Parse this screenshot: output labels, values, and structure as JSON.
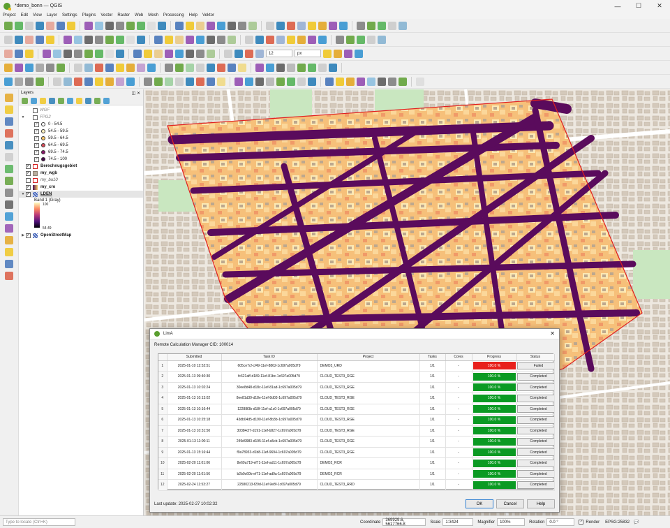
{
  "window": {
    "title": "*demo_bonn — QGIS"
  },
  "menu": [
    "Project",
    "Edit",
    "View",
    "Layer",
    "Settings",
    "Plugins",
    "Vector",
    "Raster",
    "Web",
    "Mesh",
    "Processing",
    "Help",
    "Vektor"
  ],
  "toolbar3": {
    "font_size": "12",
    "unit": "px"
  },
  "layers_panel": {
    "title": "Layers",
    "items": [
      {
        "label": "WGF",
        "kind": "hidden"
      },
      {
        "label": "FPG2",
        "kind": "group"
      },
      {
        "label": "0 - 54.5",
        "color": "#fdfdfd"
      },
      {
        "label": "54.5 - 59.5",
        "color": "#fdf1c0"
      },
      {
        "label": "59.5 - 64.5",
        "color": "#f7c66a"
      },
      {
        "label": "64.5 - 69.5",
        "color": "#d94f5c"
      },
      {
        "label": "69.5 - 74.5",
        "color": "#8b1a6a"
      },
      {
        "label": "74.5 - 100",
        "color": "#4a0c4e"
      },
      {
        "label": "Berechnugsgebiet",
        "kind": "poly"
      },
      {
        "label": "my_wgb",
        "kind": "poly"
      },
      {
        "label": "my_ba10",
        "kind": "poly"
      },
      {
        "label": "my_cro",
        "kind": "raster"
      },
      {
        "label": "LDEN",
        "kind": "raster"
      },
      {
        "label": "Band 1 (Gray)",
        "kind": "band"
      },
      {
        "label": "100",
        "kind": "rampmax"
      },
      {
        "label": "54.49",
        "kind": "rampmin"
      },
      {
        "label": "OpenStreetMap",
        "kind": "osm"
      }
    ]
  },
  "statusbar": {
    "locate_placeholder": "Type to locate (Ctrl+K)",
    "coordinate_label": "Coordinate",
    "coordinate": "369929.6, 5617766.8",
    "scale_label": "Scale",
    "scale": "1:3424",
    "magnifier_label": "Magnifier",
    "magnifier": "100%",
    "rotation_label": "Rotation",
    "rotation": "0.0 °",
    "render_label": "Render",
    "crs": "EPSG:25832"
  },
  "dialog": {
    "title": "LimA",
    "cid_label": "Remote Calculation Manager CID: 100014",
    "columns": [
      "",
      "Submitted",
      "Task ID",
      "Project",
      "Tasks",
      "Cores",
      "Progress",
      "Status"
    ],
    "rows": [
      {
        "n": "1",
        "submitted": "2025-01-10 12:52:51",
        "task": "605ce7cf-cf49-11ef-8862-1c697a005d79",
        "project": "DEMO3_URD",
        "tasks": "1/1",
        "cores": "-",
        "progress": "100.0 %",
        "progress_value": 100,
        "progress_color": "#e8201c",
        "status": "Failed"
      },
      {
        "n": "2",
        "submitted": "2025-01-13 09:40:30",
        "task": "fc621aff-d189-11ef-81bc-1c697a005d79",
        "project": "CLOUD_TEST3_RGE",
        "tasks": "1/1",
        "cores": "-",
        "progress": "100.0 %",
        "progress_value": 100,
        "progress_color": "#0b9a23",
        "status": "Completed"
      },
      {
        "n": "3",
        "submitted": "2025-01-13 10:02:24",
        "task": "30ee8d48-d18c-11ef-81ad-1c697a005d79",
        "project": "CLOUD_TEST3_RGE",
        "tasks": "1/1",
        "cores": "-",
        "progress": "100.0 %",
        "progress_value": 100,
        "progress_color": "#0b9a23",
        "status": "Completed"
      },
      {
        "n": "4",
        "submitted": "2025-01-13 10:13:02",
        "task": "8ee81d39-d18e-11ef-8d03-1c697a005d79",
        "project": "CLOUD_TEST3_RGE",
        "tasks": "1/1",
        "cores": "-",
        "progress": "100.0 %",
        "progress_value": 100,
        "progress_color": "#0b9a23",
        "status": "Completed"
      },
      {
        "n": "5",
        "submitted": "2025-01-13 10:16:44",
        "task": "12288f3b-d18f-11ef-a1c0-1c697a005d79",
        "project": "CLOUD_TEST3_RGE",
        "tasks": "1/1",
        "cores": "-",
        "progress": "100.0 %",
        "progress_value": 100,
        "progress_color": "#0b9a23",
        "status": "Completed"
      },
      {
        "n": "6",
        "submitted": "2025-01-13 10:25:18",
        "task": "43db04d5-d190-11ef-8b3b-1c697a005d79",
        "project": "CLOUD_TEST3_RGE",
        "tasks": "1/1",
        "cores": "-",
        "progress": "100.0 %",
        "progress_value": 100,
        "progress_color": "#0b9a23",
        "status": "Completed"
      },
      {
        "n": "7",
        "submitted": "2025-01-13 10:31:50",
        "task": "30384cf7-d191-11ef-b827-1c697a005d79",
        "project": "CLOUD_TEST3_RGE",
        "tasks": "1/1",
        "cores": "-",
        "progress": "100.0 %",
        "progress_value": 100,
        "progress_color": "#0b9a23",
        "status": "Completed"
      },
      {
        "n": "8",
        "submitted": "2025-01-13 11:00:11",
        "task": "249d9983-d195-11ef-a5cb-1c697a005d79",
        "project": "CLOUD_TEST3_RGE",
        "tasks": "1/1",
        "cores": "-",
        "progress": "100.0 %",
        "progress_value": 100,
        "progress_color": "#0b9a23",
        "status": "Completed"
      },
      {
        "n": "9",
        "submitted": "2025-01-13 15:16:44",
        "task": "f9a78933-d1b8-11ef-9694-1c697a005d79",
        "project": "CLOUD_TEST3_RGE",
        "tasks": "1/1",
        "cores": "-",
        "progress": "100.0 %",
        "progress_value": 100,
        "progress_color": "#0b9a23",
        "status": "Completed"
      },
      {
        "n": "10",
        "submitted": "2025-02-20 11:01:06",
        "task": "8e69a719-ef71-11ef-ad11-1c697a005d79",
        "project": "DEMO2_RCR",
        "tasks": "1/1",
        "cores": "-",
        "progress": "100.0 %",
        "progress_value": 100,
        "progress_color": "#0b9a23",
        "status": "Completed"
      },
      {
        "n": "11",
        "submitted": "2025-02-20 11:01:56",
        "task": "b2b0c60b-ef71-11ef-ad9a-1c697a005d79",
        "project": "DEMO2_RCR",
        "tasks": "1/1",
        "cores": "-",
        "progress": "100.0 %",
        "progress_value": 100,
        "progress_color": "#0b9a23",
        "status": "Completed"
      },
      {
        "n": "12",
        "submitted": "2025-02-24 11:53:27",
        "task": "22580213-f29d-11ef-9e8f-1c697a005d79",
        "project": "CLOUD_TEST3_RRD",
        "tasks": "1/1",
        "cores": "-",
        "progress": "100.0 %",
        "progress_value": 100,
        "progress_color": "#0b9a23",
        "status": "Completed"
      }
    ],
    "last_update": "Last update: 2025-02-27 10:02:32",
    "buttons": {
      "ok": "OK",
      "cancel": "Cancel",
      "help": "Help"
    }
  }
}
